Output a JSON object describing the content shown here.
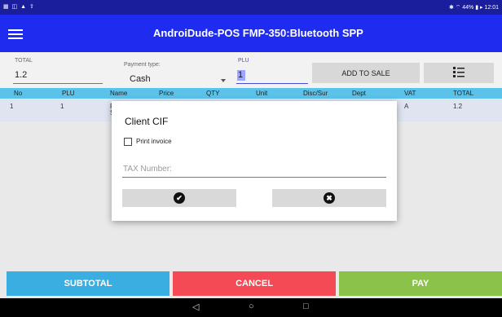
{
  "statusbar": {
    "left_icons": "▦ ◫ ▲ ⇧",
    "right_text": "✱ ⌔ 44% ▮ ▸ 12:01"
  },
  "appbar": {
    "title": "AndroiDude-POS   FMP-350:Bluetooth SPP",
    "menu_icon": "hamburger-icon"
  },
  "controls": {
    "total_label": "TOTAL",
    "total_value": "1.2",
    "payment_label": "Payment type:",
    "payment_value": "Cash",
    "plu_label": "PLU",
    "plu_value": "1",
    "add_to_sale": "ADD TO SALE",
    "list_icon": "list-view-icon"
  },
  "table": {
    "headers": [
      "No",
      "PLU",
      "Name",
      "Price",
      "QTY",
      "Unit",
      "Disc/Sur",
      "Dept",
      "VAT",
      "TOTAL"
    ],
    "row": {
      "no": "1",
      "plu": "1",
      "name_fragment_1": "F",
      "name_fragment_2": "S",
      "vat": "A",
      "total": "1.2"
    }
  },
  "dialog": {
    "title": "Client CIF",
    "checkbox_label": "Print invoice",
    "checkbox_checked": false,
    "tax_placeholder": "TAX Number:",
    "ok_icon": "check-circle-icon",
    "cancel_icon": "close-circle-icon"
  },
  "bottom": {
    "subtotal": "SUBTOTAL",
    "cancel": "CANCEL",
    "pay": "PAY",
    "colors": {
      "subtotal": "#3aaee0",
      "cancel": "#f44a55",
      "pay": "#8bc34a"
    }
  },
  "nav": {
    "back": "◁",
    "home": "○",
    "recent": "□"
  }
}
